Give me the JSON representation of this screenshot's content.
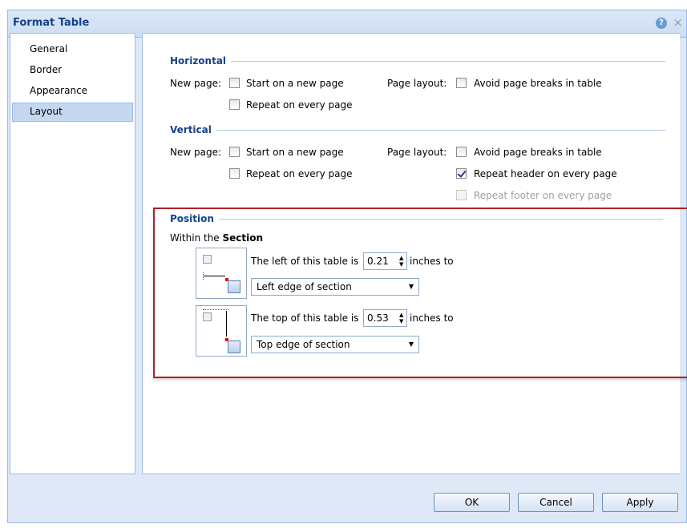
{
  "dialog": {
    "title": "Format Table",
    "help_icon": "?",
    "close_icon": "×"
  },
  "nav": {
    "items": [
      {
        "label": "General",
        "active": false
      },
      {
        "label": "Border",
        "active": false
      },
      {
        "label": "Appearance",
        "active": false
      },
      {
        "label": "Layout",
        "active": true
      }
    ]
  },
  "horizontal": {
    "title": "Horizontal",
    "new_page_label": "New page:",
    "start_new_page": {
      "label": "Start on a new page",
      "checked": false
    },
    "repeat_every_page": {
      "label": "Repeat on every page",
      "checked": false
    },
    "page_layout_label": "Page layout:",
    "avoid_breaks": {
      "label": "Avoid page breaks in table",
      "checked": false
    }
  },
  "vertical": {
    "title": "Vertical",
    "new_page_label": "New page:",
    "start_new_page": {
      "label": "Start on a new page",
      "checked": false
    },
    "repeat_every_page": {
      "label": "Repeat on every page",
      "checked": false
    },
    "page_layout_label": "Page layout:",
    "avoid_breaks": {
      "label": "Avoid page breaks in table",
      "checked": false
    },
    "repeat_header": {
      "label": "Repeat header on every page",
      "checked": true
    },
    "repeat_footer": {
      "label": "Repeat footer on every page",
      "checked": false,
      "disabled": true
    }
  },
  "position": {
    "title": "Position",
    "within_prefix": "Within the ",
    "within_bold": "Section",
    "left": {
      "text": "The left of this table is",
      "value": "0.21",
      "unit": "inches to",
      "reference": "Left edge of section"
    },
    "top": {
      "text": "The top of this table is",
      "value": "0.53",
      "unit": "inches to",
      "reference": "Top edge of section"
    }
  },
  "buttons": {
    "ok": "OK",
    "cancel": "Cancel",
    "apply": "Apply"
  },
  "glyphs": {
    "spin_up": "▲",
    "spin_down": "▼",
    "dropdown": "▼"
  },
  "colors": {
    "accent": "#15428b",
    "border": "#99bbe8",
    "highlight_frame": "#b32025",
    "dialog_bg": "#dfe8f6"
  }
}
